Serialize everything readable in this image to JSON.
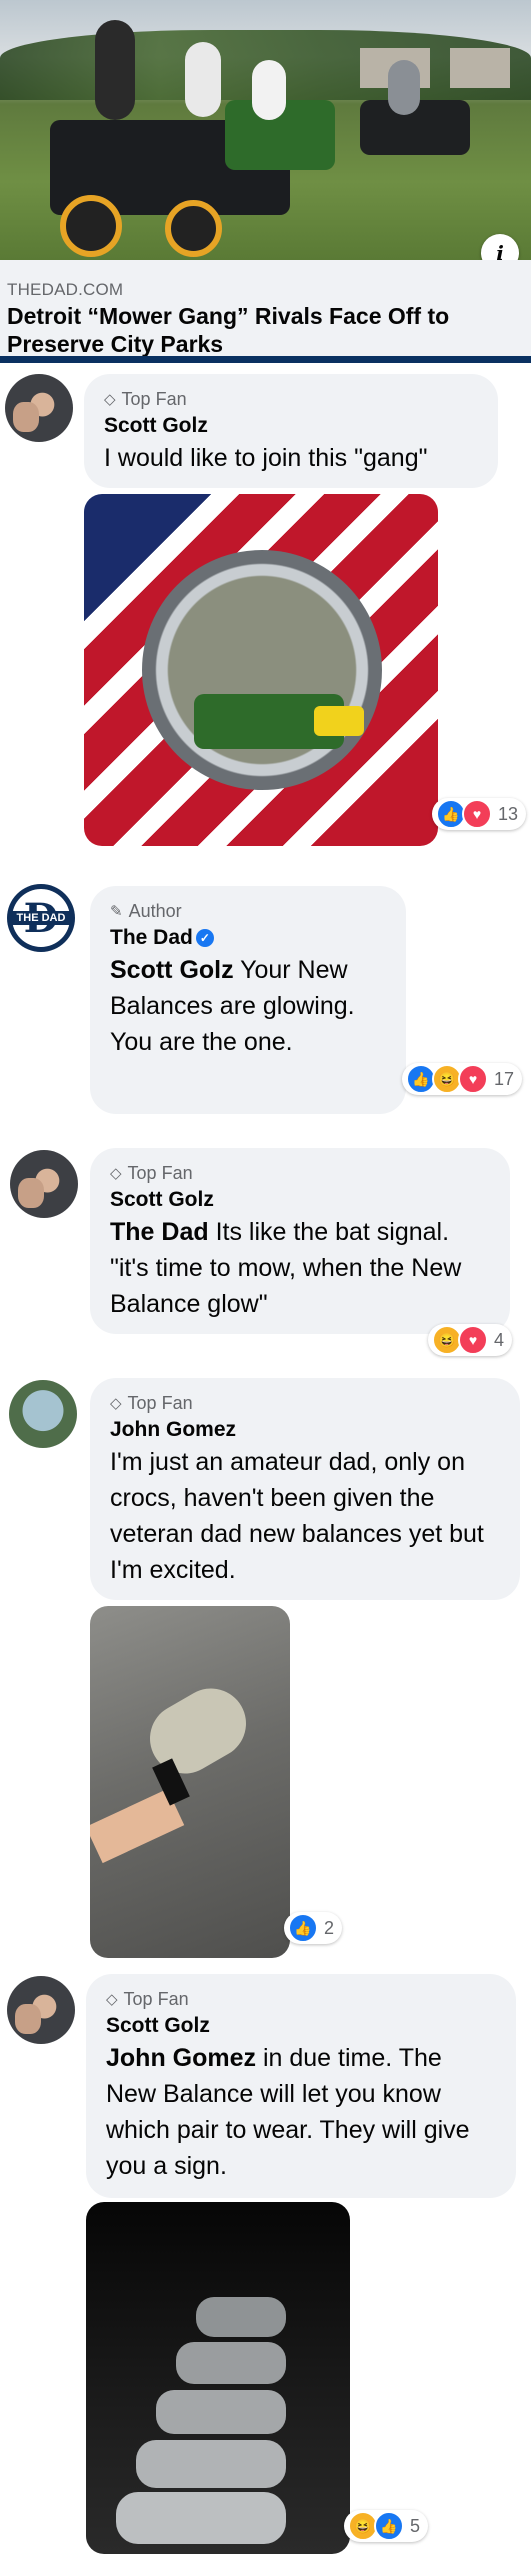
{
  "link": {
    "domain": "THEDAD.COM",
    "title": "Detroit “Mower Gang” Rivals Face Off to Preserve City Parks",
    "info_icon": "i"
  },
  "comments": [
    {
      "avatar": "scott-golz-avatar",
      "badge": "Top Fan",
      "badge_icon": "diamond-icon",
      "name": "Scott Golz",
      "text": "I would like to join this \"gang\"",
      "reactions": [
        "like",
        "love"
      ],
      "count": "13"
    },
    {
      "avatar": "the-dad-avatar",
      "avatar_label": "THE DAD",
      "badge": "Author",
      "badge_icon": "pencil-icon",
      "name": "The Dad",
      "mention": "Scott Golz",
      "text": " Your New Balances are glowing. You are the one.",
      "reactions": [
        "like",
        "haha",
        "love"
      ],
      "count": "17"
    },
    {
      "avatar": "scott-golz-avatar",
      "badge": "Top Fan",
      "badge_icon": "diamond-icon",
      "name": "Scott Golz",
      "mention": "The Dad",
      "text": " Its like the bat signal. \"it's time to mow, when the New Balance glow\"",
      "reactions": [
        "haha",
        "love"
      ],
      "count": "4"
    },
    {
      "avatar": "john-gomez-avatar",
      "badge": "Top Fan",
      "badge_icon": "diamond-icon",
      "name": "John Gomez",
      "text": "I'm just an amateur dad, only on crocs, haven't been given the veteran dad new balances yet but I'm excited.",
      "reactions": [
        "like"
      ],
      "count": "2"
    },
    {
      "avatar": "scott-golz-avatar",
      "badge": "Top Fan",
      "badge_icon": "diamond-icon",
      "name": "Scott Golz",
      "mention": "John Gomez",
      "text": " in due time. The New Balance will let you know which pair to wear. They will give you a sign.",
      "reactions": [
        "haha",
        "like"
      ],
      "count": "5"
    }
  ],
  "colors": {
    "accent": "#1877f2",
    "bubble": "#f0f2f5",
    "love": "#f33e58",
    "haha": "#f7b125",
    "brand_bar": "#0a3161"
  }
}
